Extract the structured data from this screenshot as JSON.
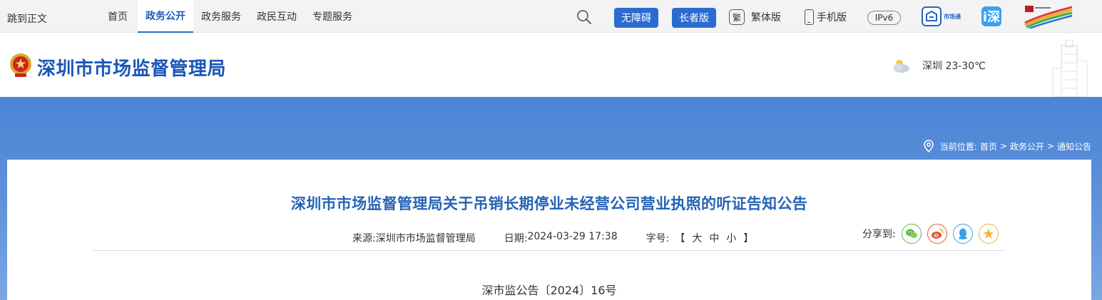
{
  "topbar": {
    "skip_label": "跳到正文",
    "nav": [
      "首页",
      "政务公开",
      "政务服务",
      "政民互动",
      "专题服务"
    ],
    "accessibility_label": "无障碍",
    "elder_label": "长者版",
    "traditional_glyph": "繁",
    "traditional_label": "繁体版",
    "mobile_label": "手机版",
    "ipv6_label": "IPv6",
    "shichangtong_label": "市场通",
    "i_shenzhen_glyph": "i深"
  },
  "header": {
    "site_title": "深圳市市场监督管理局",
    "weather": "深圳 23-30℃"
  },
  "breadcrumb": {
    "prefix": "当前位置:",
    "items": [
      "首页",
      "政务公开",
      "通知公告"
    ],
    "separator": ">"
  },
  "article": {
    "title": "深圳市市场监督管理局关于吊销长期停业未经营公司营业执照的听证告知公告",
    "source_label": "来源:",
    "source_value": "深圳市市场监督管理局",
    "date_label": "日期:",
    "date_value": "2024-03-29 17:38",
    "fontsize_label": "字号:",
    "fontsize_open": "【",
    "fontsize_options": [
      "大",
      "中",
      "小"
    ],
    "fontsize_close": "】",
    "share_label": "分享到:",
    "doc_number": "深市监公告〔2024〕16号"
  },
  "colors": {
    "brand_blue": "#1a56b7",
    "button_blue": "#2a6bd0",
    "banner_top": "#4c85d6",
    "wechat": "#5fb941",
    "weibo": "#e8573c",
    "qq": "#3aa0e6",
    "favorite": "#f0b43a"
  },
  "icons": {
    "search": "search-icon",
    "weather": "cloudy-weather-icon",
    "location": "location-pin-icon",
    "share": [
      "wechat-icon",
      "weibo-icon",
      "qq-icon",
      "favorite-star-icon"
    ]
  }
}
